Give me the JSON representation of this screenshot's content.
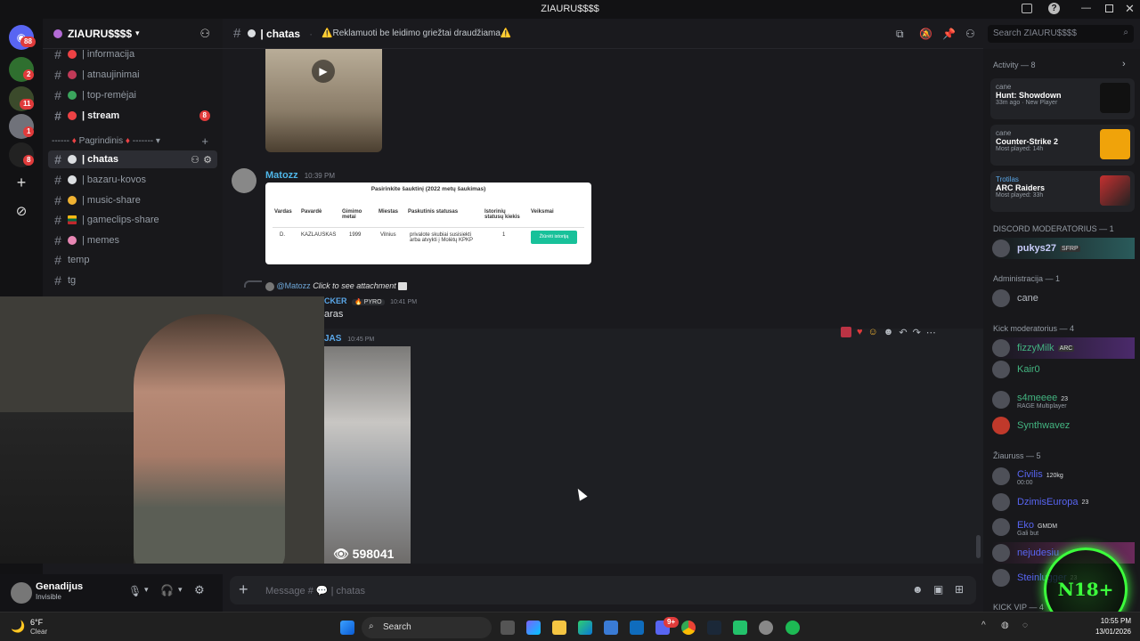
{
  "window": {
    "title": "ZIAURU$$$$"
  },
  "server": {
    "name": "ZIAURU$$$$"
  },
  "server_badges": [
    "88",
    "2",
    "11",
    "1",
    "8"
  ],
  "channels": [
    {
      "label": "| informacija",
      "color": "#ed4245"
    },
    {
      "label": "| atnaujinimai",
      "color": "#ed4245"
    },
    {
      "label": "| top-remėjai",
      "color": "#3ba55d"
    },
    {
      "label": "| stream",
      "color": "#ed4245",
      "badge": "8"
    }
  ],
  "category": {
    "label": "Pagrindinis"
  },
  "channels2": [
    {
      "label": "| chatas"
    },
    {
      "label": "| bazaru-kovos"
    },
    {
      "label": "| music-share"
    },
    {
      "label": "| gameclips-share"
    },
    {
      "label": "| memes"
    },
    {
      "label": "temp"
    },
    {
      "label": "tg"
    }
  ],
  "header": {
    "channel": "| chatas",
    "topic": "⚠️Reklamuoti be leidimo griežtai draudžiama⚠️",
    "search_placeholder": "Search ZIAURU$$$$"
  },
  "messages": {
    "m1": {
      "author": "Matozz",
      "time": "10:39 PM"
    },
    "table": {
      "title": "Pasirinkite šauktinį (2022 metų šaukimas)",
      "headers": [
        "Vardas",
        "Pavardė",
        "Gimimo metai",
        "Miestas",
        "Paskutinis statusas",
        "Istorinių statusų kiekis",
        "Veiksmai"
      ],
      "row": [
        "D.",
        "KAZLAUSKAS",
        "1999",
        "Vilnius",
        "privalote skubiai susisiekti arba atvykti į Molėtų KPKP",
        "1"
      ],
      "button": "Žiūrėti istoriją"
    },
    "reply": {
      "mention": "@Matozz",
      "text": "Click to see attachment"
    },
    "m2": {
      "author_tail": "CKER",
      "tag": "PYRO",
      "time": "10:41 PM",
      "text": "aras"
    },
    "m3": {
      "author_tail": "JAS",
      "time": "10:45 PM",
      "views": "598041"
    }
  },
  "composer": {
    "placeholder": "Message # 💬 | chatas"
  },
  "user": {
    "name": "Genadijus",
    "status": "Invisible"
  },
  "members": {
    "activity_title": "Activity — 8",
    "activities": [
      {
        "user": "cane",
        "game": "Hunt: Showdown",
        "meta": "33m ago",
        "extra": "New Player"
      },
      {
        "user": "cane",
        "game": "Counter-Strike 2",
        "meta": "Most played: 14h"
      },
      {
        "user": "Trotilas",
        "game": "ARC Raiders",
        "meta": "Most played: 33h"
      }
    ],
    "groups": [
      {
        "title": "DISCORD MODERATORIUS — 1",
        "items": [
          {
            "name": "pukys27",
            "tag": "SFRP",
            "color": "#c9cdfb"
          }
        ]
      },
      {
        "title": "Administracija — 1",
        "items": [
          {
            "name": "cane",
            "color": "#b5bac1"
          }
        ]
      },
      {
        "title": "Kick moderatorius — 4",
        "items": [
          {
            "name": "fizzyMilk",
            "tag": "ARC",
            "color": "#43b581"
          },
          {
            "name": "Kair0",
            "color": "#43b581"
          },
          {
            "name": "s4meeee",
            "tag": "23",
            "sub": "RAGE Multiplayer",
            "color": "#43b581"
          },
          {
            "name": "Synthwavez",
            "color": "#43b581"
          }
        ]
      },
      {
        "title": "Žiauruss — 5",
        "items": [
          {
            "name": "Civilis",
            "tag": "120kg",
            "sub": "00:00",
            "color": "#5865f2"
          },
          {
            "name": "DzimisEuropa",
            "tag": "23",
            "color": "#5865f2"
          },
          {
            "name": "Eko",
            "tag": "GMDM",
            "sub": "Gali but",
            "color": "#5865f2"
          },
          {
            "name": "nejudesiu",
            "color": "#5865f2"
          },
          {
            "name": "Steinlugger",
            "tag": "23",
            "color": "#5865f2"
          }
        ]
      },
      {
        "title": "KICK VIP — 4",
        "items": []
      }
    ]
  },
  "overlay": {
    "badge": "N18+"
  },
  "taskbar": {
    "weather_temp": "6°F",
    "weather_desc": "Clear",
    "search": "Search",
    "time": "10:55 PM",
    "date": "13/01/2026",
    "discord_badge": "9+"
  }
}
